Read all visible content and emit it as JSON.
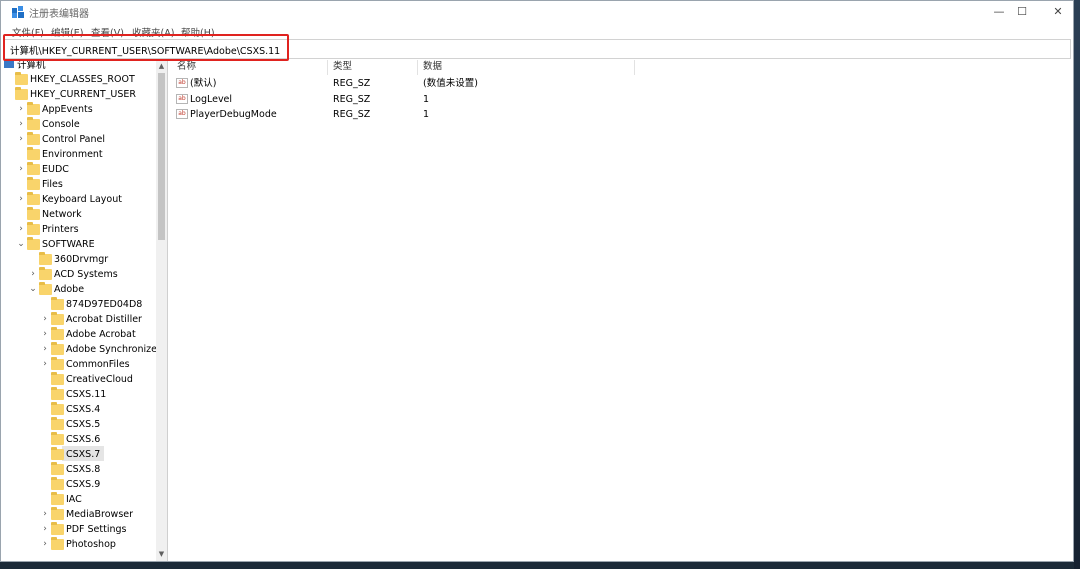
{
  "window": {
    "title": "注册表编辑器"
  },
  "controls": {
    "minimize": "—",
    "maximize": "☐",
    "close": "✕"
  },
  "menu": [
    "文件(F)",
    "编辑(E)",
    "查看(V)",
    "收藏夹(A)",
    "帮助(H)"
  ],
  "address": "计算机\\HKEY_CURRENT_USER\\SOFTWARE\\Adobe\\CSXS.11",
  "tree": {
    "root": "计算机",
    "items": [
      {
        "label": "HKEY_CLASSES_ROOT",
        "level": 0,
        "expander": ""
      },
      {
        "label": "HKEY_CURRENT_USER",
        "level": 0,
        "expander": ""
      },
      {
        "label": "AppEvents",
        "level": 1,
        "expander": ">"
      },
      {
        "label": "Console",
        "level": 1,
        "expander": ">"
      },
      {
        "label": "Control Panel",
        "level": 1,
        "expander": ">"
      },
      {
        "label": "Environment",
        "level": 1,
        "expander": ""
      },
      {
        "label": "EUDC",
        "level": 1,
        "expander": ">"
      },
      {
        "label": "Files",
        "level": 1,
        "expander": ""
      },
      {
        "label": "Keyboard Layout",
        "level": 1,
        "expander": ">"
      },
      {
        "label": "Network",
        "level": 1,
        "expander": ""
      },
      {
        "label": "Printers",
        "level": 1,
        "expander": ">"
      },
      {
        "label": "SOFTWARE",
        "level": 1,
        "expander": "v"
      },
      {
        "label": "360Drvmgr",
        "level": 2,
        "expander": ""
      },
      {
        "label": "ACD Systems",
        "level": 2,
        "expander": ">"
      },
      {
        "label": "Adobe",
        "level": 2,
        "expander": "v"
      },
      {
        "label": "874D97ED04D8",
        "level": 3,
        "expander": ""
      },
      {
        "label": "Acrobat Distiller",
        "level": 3,
        "expander": ">"
      },
      {
        "label": "Adobe Acrobat",
        "level": 3,
        "expander": ">"
      },
      {
        "label": "Adobe Synchronizer",
        "level": 3,
        "expander": ">"
      },
      {
        "label": "CommonFiles",
        "level": 3,
        "expander": ">"
      },
      {
        "label": "CreativeCloud",
        "level": 3,
        "expander": ""
      },
      {
        "label": "CSXS.11",
        "level": 3,
        "expander": "",
        "selected": true
      },
      {
        "label": "CSXS.4",
        "level": 3,
        "expander": ""
      },
      {
        "label": "CSXS.5",
        "level": 3,
        "expander": ""
      },
      {
        "label": "CSXS.6",
        "level": 3,
        "expander": ""
      },
      {
        "label": "CSXS.7",
        "level": 3,
        "expander": ""
      },
      {
        "label": "CSXS.8",
        "level": 3,
        "expander": ""
      },
      {
        "label": "CSXS.9",
        "level": 3,
        "expander": ""
      },
      {
        "label": "IAC",
        "level": 3,
        "expander": ""
      },
      {
        "label": "MediaBrowser",
        "level": 3,
        "expander": ">"
      },
      {
        "label": "PDF Settings",
        "level": 3,
        "expander": ">"
      },
      {
        "label": "Photoshop",
        "level": 3,
        "expander": ">"
      }
    ]
  },
  "list": {
    "headers": [
      "名称",
      "类型",
      "数据"
    ],
    "rows": [
      {
        "name": "(默认)",
        "type": "REG_SZ",
        "data": "(数值未设置)"
      },
      {
        "name": "LogLevel",
        "type": "REG_SZ",
        "data": "1"
      },
      {
        "name": "PlayerDebugMode",
        "type": "REG_SZ",
        "data": "1"
      }
    ],
    "icon_text": "ab"
  },
  "colors": {
    "highlight": "#e0231f",
    "folder": "#f9d46b",
    "selected": "#e5e5e5"
  }
}
